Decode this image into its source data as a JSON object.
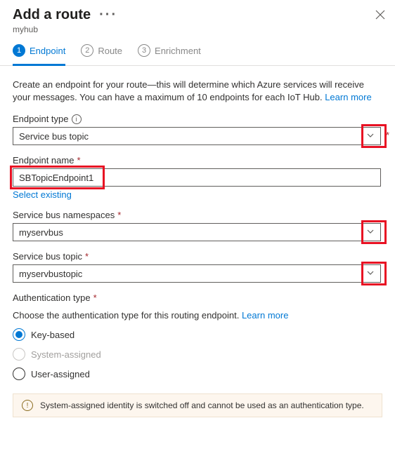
{
  "header": {
    "title": "Add a route",
    "subtitle": "myhub"
  },
  "tabs": [
    {
      "num": "1",
      "label": "Endpoint"
    },
    {
      "num": "2",
      "label": "Route"
    },
    {
      "num": "3",
      "label": "Enrichment"
    }
  ],
  "intro": {
    "text": "Create an endpoint for your route—this will determine which Azure services will receive your messages. You can have a maximum of 10 endpoints for each IoT Hub.",
    "link": "Learn more"
  },
  "fields": {
    "endpoint_type": {
      "label": "Endpoint type",
      "value": "Service bus topic"
    },
    "endpoint_name": {
      "label": "Endpoint name",
      "value": "SBTopicEndpoint1",
      "select_existing": "Select existing"
    },
    "namespaces": {
      "label": "Service bus namespaces",
      "value": "myservbus"
    },
    "topic": {
      "label": "Service bus topic",
      "value": "myservbustopic"
    },
    "auth_type": {
      "label": "Authentication type",
      "helper": "Choose the authentication type for this routing endpoint.",
      "helper_link": "Learn more",
      "options": {
        "key": "Key-based",
        "system": "System-assigned",
        "user": "User-assigned"
      }
    }
  },
  "banner": "System-assigned identity is switched off and cannot be used as an authentication type."
}
